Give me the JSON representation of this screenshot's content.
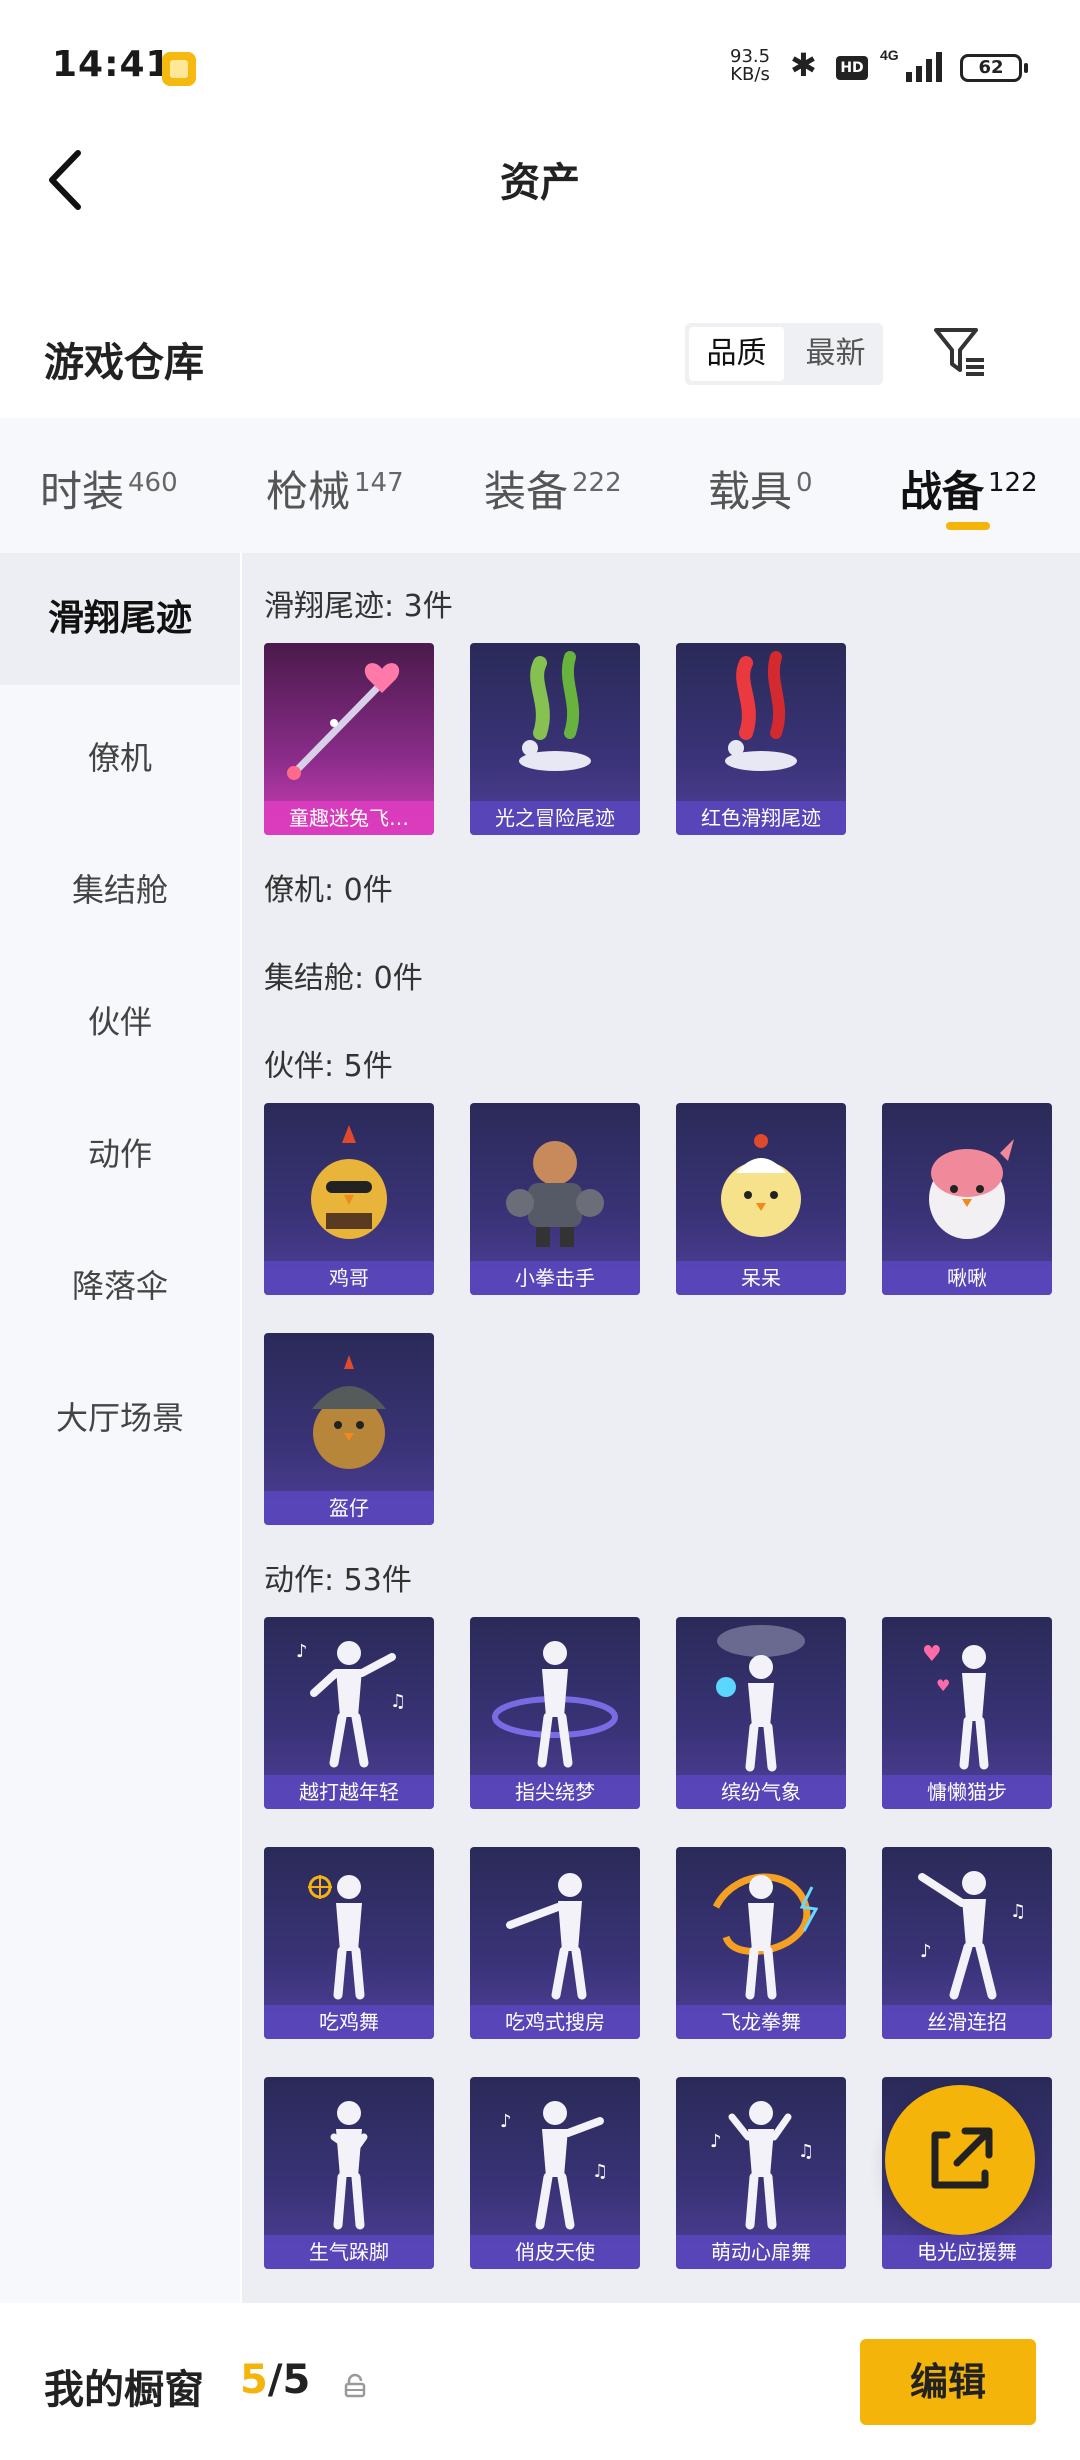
{
  "status_bar": {
    "time": "14:41",
    "speed": "93.5",
    "speed_unit": "KB/s",
    "network": "4G",
    "hd": "HD",
    "battery": "62"
  },
  "header": {
    "title": "资产"
  },
  "warehouse": {
    "title": "游戏仓库",
    "sort_options": [
      "品质",
      "最新"
    ],
    "sort_active": "品质"
  },
  "category_tabs": [
    {
      "label": "时装",
      "count": "460"
    },
    {
      "label": "枪械",
      "count": "147"
    },
    {
      "label": "装备",
      "count": "222"
    },
    {
      "label": "载具",
      "count": "0"
    },
    {
      "label": "战备",
      "count": "122",
      "active": true
    }
  ],
  "sidebar": [
    "滑翔尾迹",
    "僚机",
    "集结舱",
    "伙伴",
    "动作",
    "降落伞",
    "大厅场景"
  ],
  "sections": {
    "glide": {
      "title": "滑翔尾迹: 3件",
      "items": [
        "童趣迷兔飞…",
        "光之冒险尾迹",
        "红色滑翔尾迹"
      ]
    },
    "wingman": {
      "title": "僚机: 0件"
    },
    "capsule": {
      "title": "集结舱: 0件"
    },
    "partner": {
      "title": "伙伴: 5件",
      "items": [
        "鸡哥",
        "小拳击手",
        "呆呆",
        "啾啾",
        "盔仔"
      ]
    },
    "action": {
      "title": "动作: 53件",
      "items": [
        "越打越年轻",
        "指尖绕梦",
        "缤纷气象",
        "慵懒猫步",
        "吃鸡舞",
        "吃鸡式搜房",
        "飞龙拳舞",
        "丝滑连招",
        "生气跺脚",
        "俏皮天使",
        "萌动心扉舞",
        "电光应援舞"
      ]
    }
  },
  "bottom_bar": {
    "showcase_label": "我的橱窗",
    "showcase_current": "5",
    "showcase_total": "/5",
    "edit_label": "编辑"
  },
  "colors": {
    "accent": "#f5b40a",
    "card_purple": "#3a3378",
    "card_pink": "#d040b8"
  }
}
